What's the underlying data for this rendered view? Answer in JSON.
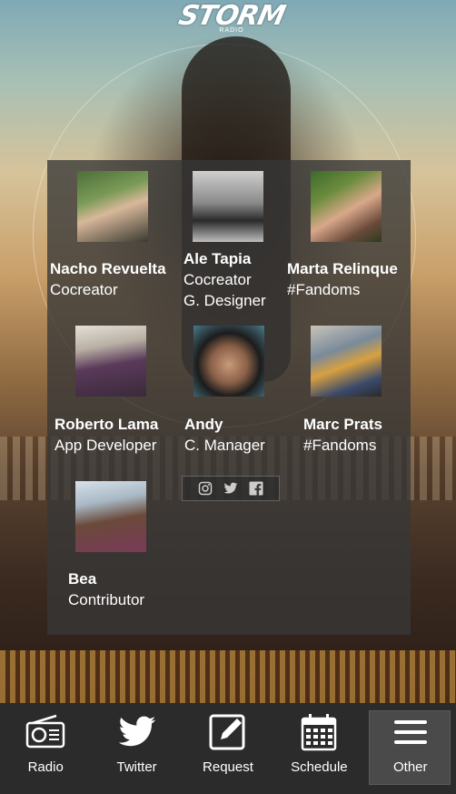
{
  "app": {
    "logo_text": "STORM",
    "logo_sub": "RADIO"
  },
  "team": [
    {
      "name": "Nacho Revuelta",
      "roles": [
        "Cocreator"
      ]
    },
    {
      "name": "Ale Tapia",
      "roles": [
        "Cocreator",
        "G. Designer"
      ]
    },
    {
      "name": "Marta Relinque",
      "roles": [
        "#Fandoms"
      ]
    },
    {
      "name": "Roberto Lama",
      "roles": [
        "App Developer"
      ]
    },
    {
      "name": "Andy",
      "roles": [
        "C. Manager"
      ]
    },
    {
      "name": "Marc Prats",
      "roles": [
        "#Fandoms"
      ]
    },
    {
      "name": "Bea",
      "roles": [
        "Contributor"
      ]
    }
  ],
  "social": [
    "instagram-icon",
    "twitter-icon",
    "facebook-icon"
  ],
  "tabs": [
    {
      "label": "Radio",
      "icon": "radio-icon"
    },
    {
      "label": "Twitter",
      "icon": "twitter-icon"
    },
    {
      "label": "Request",
      "icon": "edit-icon"
    },
    {
      "label": "Schedule",
      "icon": "calendar-icon"
    },
    {
      "label": "Other",
      "icon": "menu-icon",
      "active": true
    }
  ]
}
